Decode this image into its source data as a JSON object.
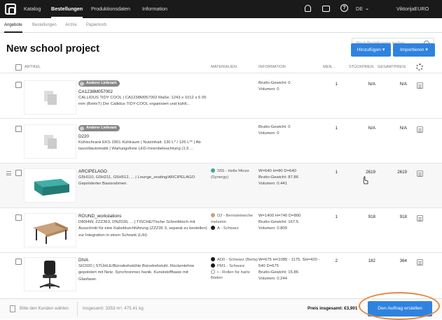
{
  "topbar": {
    "nav": [
      "Katalog",
      "Bestellungen",
      "Produktionsdaten",
      "Information"
    ],
    "language": "DE",
    "user": "ViktorijaEURO"
  },
  "subtabs": [
    "Angebote",
    "Bestellungen",
    "Archiv",
    "Papierkorb"
  ],
  "search": {
    "placeholder": "Nach Bestellungen suchen"
  },
  "page": {
    "title": "New school project",
    "add_button": "Hinzufügen",
    "import_button": "Importieren"
  },
  "table": {
    "headers": [
      "ARTIKEL",
      "MATERIALIEN",
      "INFORMATION",
      "MEN...",
      "STÜCKPREIS",
      "GESAMTPREIS"
    ],
    "rows": [
      {
        "badge": "Anderer Lieferant",
        "name": "CA1238M057002",
        "desc": "CALLIDUS TIDY COOL | CA1238M057002 Maße: 1243 x 1012 x 6 05 mm (BxHxT) Der Callidus TIDY-COOL organisiert und kühlt...",
        "materials": [],
        "info": [
          "Brutto-Gewicht: 0",
          "Volumen: 0"
        ],
        "qty": "1",
        "unit_price": "N/A",
        "total": "N/A"
      },
      {
        "badge": "Anderer Lieferant",
        "name": "D220",
        "desc": "Kühlschrank EKS 2901 Kühlraum | Nutzinhalt: 130 L* / 126 L** | Ab tauvollautomatik | Wartungsfreie LED-Innenbeleuchtung (1,5 ...",
        "materials": [],
        "info": [
          "Brutto-Gewicht: 0",
          "Volumen: 0"
        ],
        "qty": "1",
        "unit_price": "N/A",
        "total": "N/A"
      },
      {
        "badge": "",
        "name": "ARCIPELAGO",
        "desc": "G5H110, G5H211, G5H512, ... | Lounge_seating/ARCIPELAGO Gepolsterter Basisrahmen.",
        "materials": [
          {
            "text": "S55 - Helle Minze (Synergy)",
            "color": "#3aa79b"
          }
        ],
        "info": [
          "W=640 H=80 D=640",
          "Brutto-Gewicht: 87.86",
          "Volumen: 0.441"
        ],
        "qty": "1",
        "unit_price": "2619",
        "total": "2619"
      },
      {
        "badge": "",
        "name": "ROUND_workstations",
        "desc": "D80I4W, ZZZ363, DNZ030, ... | TISCHE/Tische Schreibtisch mit Ausschnitt für eine Kabeldurchführung (ZZZ36 3, separat zu bestellen) zur Integration in einen Schrank (L/H)",
        "materials": [
          {
            "text": "D2 - Bernsteineiche melamin",
            "color": "#c9a27a"
          },
          {
            "text": "A - Schwarz",
            "color": "#1a1a1a"
          }
        ],
        "info": [
          "W=1400 H=740 D=800",
          "Brutto-Gewicht: 167.5",
          "Volumen: 0.809"
        ],
        "qty": "1",
        "unit_price": "918",
        "total": "918"
      },
      {
        "badge": "",
        "name": "DIVA",
        "desc": "SIC020 | STÜHLE/Bürodrehstühle Bürodrehstuhl. Rückenlehne gepolstert mit Netz. Synchronmec hanik. Kunststoffbasis mit Glasfaser.",
        "materials": [
          {
            "text": "AD0 - Schwarz (Berta)",
            "color": "#1a1a1a"
          },
          {
            "text": "PM1 - Schwarz",
            "color": "#1a1a1a"
          },
          {
            "text": "• - Rollen für harte Böden",
            "color": "#ffffff"
          }
        ],
        "info": [
          "W=675 H=1085 - 1175, SH=420 - 540 D=675",
          "Brutto-Gewicht: 15.86",
          "Volumen: 0.244"
        ],
        "qty": "2",
        "unit_price": "182",
        "total": "364"
      }
    ]
  },
  "footer": {
    "customer": "Bitte den Kunden wählen",
    "totals": "Insgesamt: 3353 m³,   475.41 kg",
    "price_total": "Preis insgesamt: €3,901",
    "order_button": "Den Auftrag erstellen"
  },
  "colors": {
    "accent": "#2f83df",
    "topbar": "#1a1a1a",
    "highlight": "#e8873a"
  }
}
